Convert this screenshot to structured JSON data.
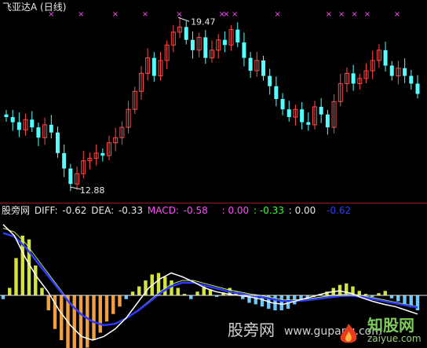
{
  "header": {
    "title": "飞亚达A (日线)"
  },
  "price_panel": {
    "high_label": "19.47",
    "low_label": "12.88"
  },
  "indicator_row": {
    "name": "股旁网",
    "diff_label": "DIFF:",
    "diff_value": "-0.62",
    "dea_label": "DEA:",
    "dea_value": "-0.33",
    "macd_label": "MACD:",
    "macd_value": "-0.58",
    "v1": ": 0.00",
    "v2": ": -0.33",
    "v3": ": 0.00",
    "v4": "-0.62"
  },
  "colors": {
    "up": "#ff4a4a",
    "down": "#54ffff",
    "magenta": "#ff4dff",
    "diff": "#ffffff",
    "dea": "#c8e66e",
    "blue": "#2e3bff",
    "hist_pos": "#d4e43c",
    "hist_neg_light": "#6ec8ff",
    "hist_neg_warm": "#f0a040"
  },
  "watermark": {
    "left": "股旁网",
    "domain": "www.gupang.com",
    "logo_cn": "知股网",
    "logo_url": "zaiyue.com"
  },
  "chart_data": [
    {
      "type": "candlestick",
      "title": "飞亚达A (日线)",
      "annotations": [
        {
          "text": "19.47",
          "kind": "max"
        },
        {
          "text": "12.88",
          "kind": "min"
        }
      ],
      "close_trend": [
        15.6,
        15.4,
        15.1,
        15.5,
        15.2,
        14.8,
        15.3,
        15.0,
        14.2,
        13.6,
        13.0,
        13.4,
        13.9,
        14.0,
        14.2,
        14.1,
        14.6,
        14.8,
        15.2,
        15.9,
        16.6,
        17.3,
        17.9,
        17.2,
        17.8,
        18.4,
        18.9,
        19.1,
        18.6,
        18.2,
        18.7,
        17.9,
        18.2,
        18.6,
        18.4,
        19.0,
        18.5,
        17.9,
        17.4,
        17.8,
        17.2,
        16.8,
        16.3,
        15.9,
        15.6,
        15.9,
        15.4,
        15.3,
        16.0,
        15.7,
        15.2,
        16.2,
        16.9,
        17.3,
        16.9,
        17.1,
        17.4,
        17.8,
        18.2,
        17.6,
        17.2,
        17.5,
        17.2,
        16.9,
        16.5
      ],
      "markers": {
        "symbol": "×",
        "count": 14
      }
    },
    {
      "type": "bar",
      "title": "股旁网",
      "series": [
        {
          "name": "DIFF",
          "last": -0.62
        },
        {
          "name": "DEA",
          "last": -0.33
        },
        {
          "name": "MACD",
          "last": -0.58
        }
      ],
      "histogram": [
        -0.05,
        0.1,
        0.5,
        0.8,
        0.75,
        0.4,
        0.1,
        -0.2,
        -0.45,
        -0.6,
        -0.75,
        -0.85,
        -0.8,
        -0.7,
        -0.6,
        -0.5,
        -0.35,
        -0.25,
        -0.15,
        -0.05,
        0.05,
        0.12,
        0.2,
        0.28,
        0.3,
        0.25,
        0.2,
        0.1,
        0.02,
        -0.05,
        0.05,
        0.12,
        0.08,
        -0.02,
        0.04,
        0.1,
        0.05,
        -0.05,
        -0.1,
        -0.12,
        -0.15,
        -0.18,
        -0.2,
        -0.2,
        -0.18,
        -0.12,
        -0.08,
        -0.05,
        -0.02,
        0.02,
        0.05,
        0.1,
        0.14,
        0.16,
        0.12,
        0.06,
        0.02,
        -0.02,
        0.03,
        0.06,
        -0.04,
        -0.08,
        -0.12,
        -0.16,
        -0.2
      ],
      "diff_line": [
        0.95,
        0.8,
        0.5,
        0.25,
        0.05,
        -0.2,
        -0.4,
        -0.55,
        -0.6,
        -0.55,
        -0.45,
        -0.3,
        -0.1,
        0.1,
        0.22,
        0.3,
        0.25,
        0.18,
        0.1,
        0.05,
        0.02,
        0.0,
        -0.02,
        -0.05,
        -0.1,
        -0.12,
        -0.08,
        -0.04,
        0.0,
        0.04,
        0.06,
        0.03,
        -0.03,
        -0.08,
        -0.12,
        -0.15,
        -0.2,
        -0.25
      ],
      "dea_line": [
        0.9,
        0.85,
        0.7,
        0.5,
        0.3,
        0.1,
        -0.1,
        -0.25,
        -0.35,
        -0.4,
        -0.38,
        -0.3,
        -0.2,
        -0.08,
        0.05,
        0.15,
        0.2,
        0.2,
        0.16,
        0.12,
        0.08,
        0.05,
        0.02,
        0.0,
        -0.03,
        -0.06,
        -0.06,
        -0.05,
        -0.03,
        -0.01,
        0.01,
        0.02,
        0.0,
        -0.03,
        -0.06,
        -0.09,
        -0.12,
        -0.15
      ]
    }
  ]
}
